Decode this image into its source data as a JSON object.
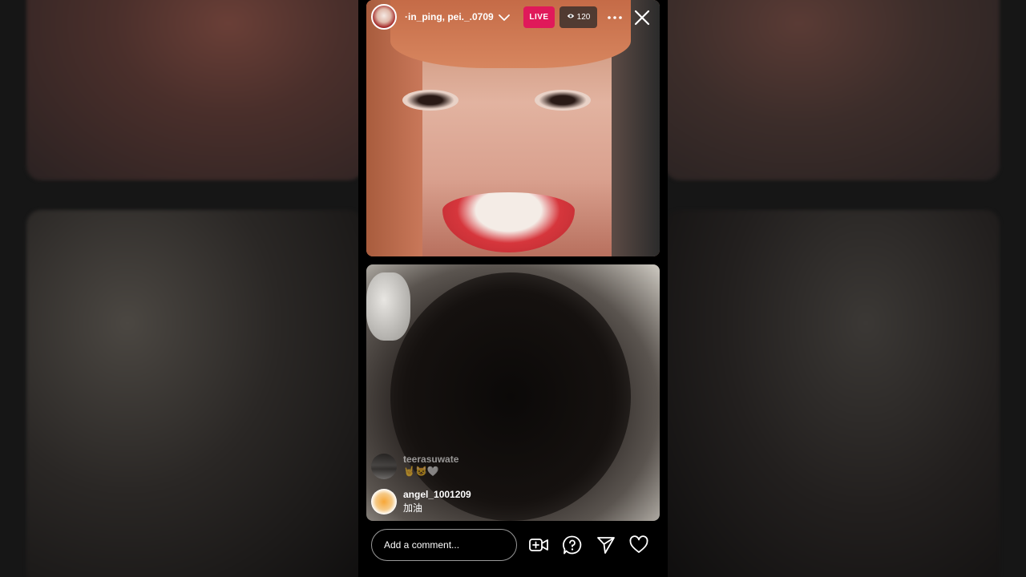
{
  "header": {
    "host_names": "·in_ping, pei._.0709",
    "live_label": "LIVE",
    "viewer_count": "120"
  },
  "comments": [
    {
      "user": "teerasuwate",
      "text": "🤘😺🤍"
    },
    {
      "user": "angel_1001209",
      "text": "加油"
    }
  ],
  "bottom_bar": {
    "comment_placeholder": "Add a comment..."
  },
  "icons": {
    "viewer": "eye-icon",
    "more": "more-icon",
    "close": "close-icon",
    "chevron": "chevron-down-icon",
    "video_request": "video-add-icon",
    "question": "question-icon",
    "share": "send-icon",
    "like": "heart-icon"
  },
  "colors": {
    "live_badge": "#e0195a",
    "background": "#000000"
  }
}
